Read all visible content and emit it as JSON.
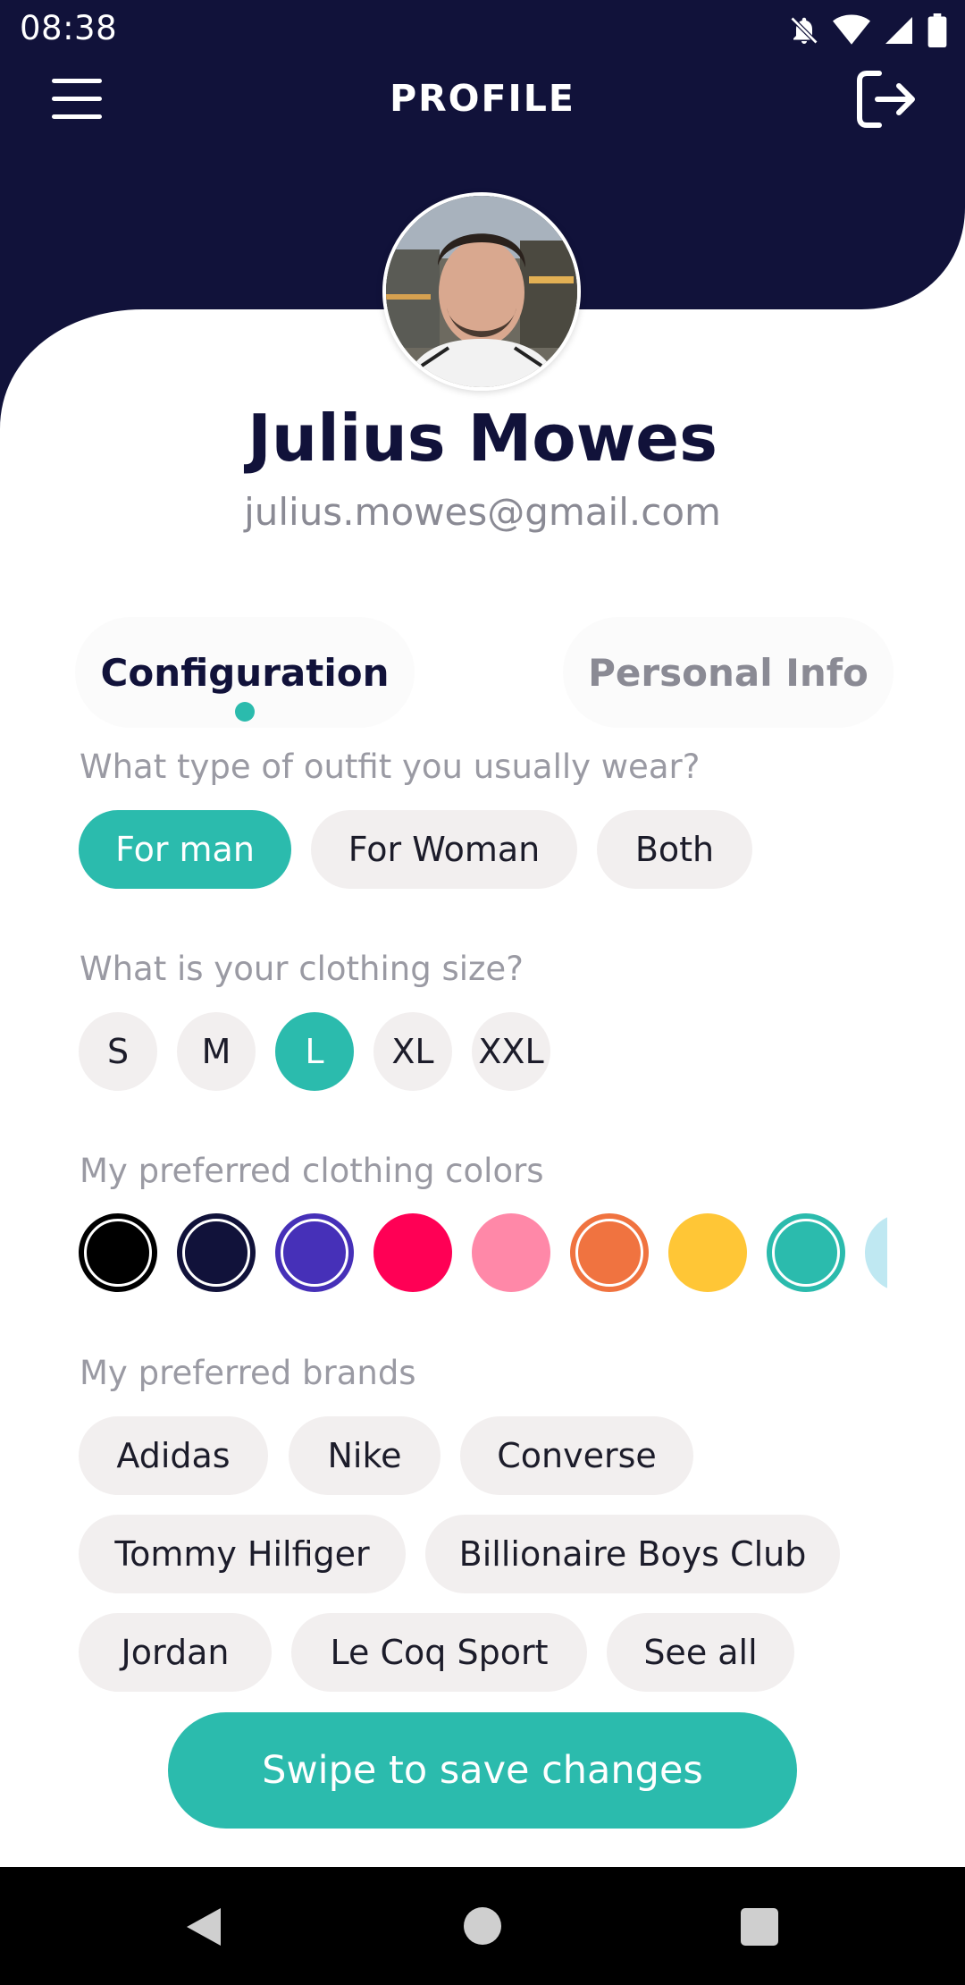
{
  "status_bar": {
    "time": "08:38",
    "icons": [
      "notifications-off-icon",
      "wifi-icon",
      "signal-icon",
      "battery-icon"
    ]
  },
  "app_bar": {
    "title": "PROFILE",
    "menu_icon": "hamburger-menu-icon",
    "logout_icon": "logout-icon"
  },
  "profile": {
    "name": "Julius Mowes",
    "email": "julius.mowes@gmail.com"
  },
  "tabs": [
    {
      "label": "Configuration",
      "active": true
    },
    {
      "label": "Personal Info",
      "active": false
    }
  ],
  "outfit": {
    "question": "What type of outfit you usually wear?",
    "options": [
      "For man",
      "For Woman",
      "Both"
    ],
    "selected": "For man"
  },
  "size": {
    "question": "What is your clothing size?",
    "options": [
      "S",
      "M",
      "L",
      "XL",
      "XXL"
    ],
    "selected": "L"
  },
  "colors": {
    "question": "My preferred clothing colors",
    "swatches": [
      "#000000",
      "#11123a",
      "#4630b8",
      "#ff0055",
      "#ff88a8",
      "#f07340",
      "#ffc636",
      "#2bbbad",
      "#bfe8f2"
    ]
  },
  "brands": {
    "question": "My preferred brands",
    "items": [
      "Adidas",
      "Nike",
      "Converse",
      "Tommy Hilfiger",
      "Billionaire Boys Club",
      "Jordan",
      "Le Coq Sport",
      "See all"
    ]
  },
  "save_button": {
    "label": "Swipe to save changes"
  },
  "theme": {
    "header": "#11123a",
    "accent": "#2bbbad"
  }
}
